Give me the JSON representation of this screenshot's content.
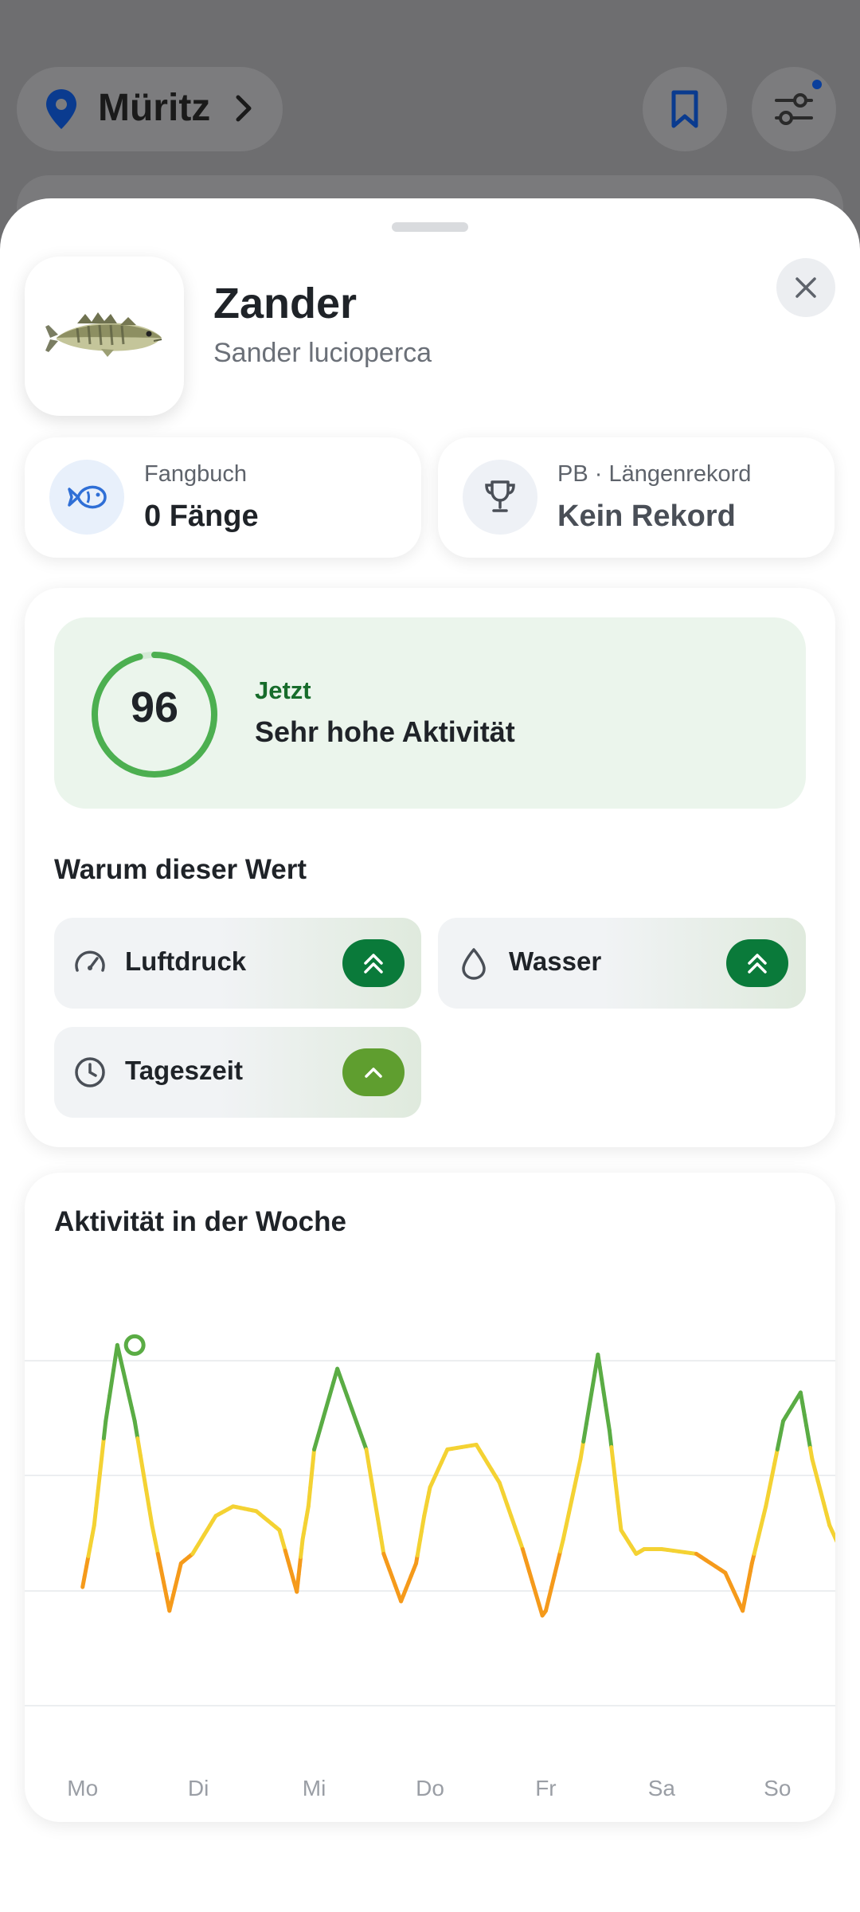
{
  "background": {
    "location": {
      "name": "Müritz"
    },
    "icons": {
      "pin": "map-pin-icon",
      "chevron": "chevron-right-icon",
      "bookmark": "bookmark-icon",
      "filter": "filter-sliders-icon"
    }
  },
  "species": {
    "name": "Zander",
    "latin": "Sander lucioperca",
    "image": "zander-fish-illustration"
  },
  "stats": {
    "catchbook": {
      "label": "Fangbuch",
      "value": "0 Fänge",
      "icon": "fish-icon"
    },
    "record": {
      "label": "PB · Längenrekord",
      "value": "Kein Rekord",
      "icon": "trophy-icon"
    }
  },
  "activity": {
    "score": 96,
    "score_fraction": 0.96,
    "now_label": "Jetzt",
    "status": "Sehr hohe Aktivität",
    "why_title": "Warum dieser Wert",
    "factors": [
      {
        "label": "Luftdruck",
        "icon": "gauge-icon",
        "trend": "strong-up",
        "pill_color": "#0a7a3a"
      },
      {
        "label": "Wasser",
        "icon": "water-drop-icon",
        "trend": "strong-up",
        "pill_color": "#0a7a3a"
      },
      {
        "label": "Tageszeit",
        "icon": "clock-icon",
        "trend": "up",
        "pill_color": "#5f9e2f"
      }
    ]
  },
  "week": {
    "title": "Aktivität in der Woche"
  },
  "chart_data": {
    "type": "line",
    "days": [
      "Mo",
      "Di",
      "Mi",
      "Do",
      "Fr",
      "Sa",
      "So"
    ],
    "x": [
      0,
      0.1,
      0.2,
      0.3,
      0.45,
      0.6,
      0.75,
      0.85,
      0.95,
      1.0,
      1.15,
      1.3,
      1.5,
      1.7,
      1.85,
      1.9,
      1.95,
      2.0,
      2.2,
      2.45,
      2.6,
      2.75,
      2.88,
      2.95,
      3.0,
      3.15,
      3.4,
      3.6,
      3.8,
      3.97,
      4.0,
      4.15,
      4.3,
      4.45,
      4.55,
      4.65,
      4.78,
      4.85,
      5.0,
      5.3,
      5.55,
      5.7,
      5.78,
      5.9,
      6.05,
      6.2,
      6.3,
      6.45,
      6.6
    ],
    "y": [
      45,
      58,
      80,
      96,
      80,
      58,
      40,
      50,
      52,
      54,
      60,
      62,
      61,
      57,
      44,
      55,
      62,
      74,
      91,
      74,
      52,
      42,
      50,
      60,
      66,
      74,
      75,
      67,
      53,
      39,
      40,
      55,
      72,
      94,
      78,
      57,
      52,
      53,
      53,
      52,
      48,
      40,
      50,
      62,
      80,
      86,
      72,
      58,
      50
    ],
    "highlight": {
      "x": 0.45,
      "y": 96
    },
    "color_scale": {
      "high": "#5aac44",
      "mid": "#f4d233",
      "low": "#f59a1b"
    },
    "ylim": [
      20,
      110
    ],
    "grid": true
  }
}
